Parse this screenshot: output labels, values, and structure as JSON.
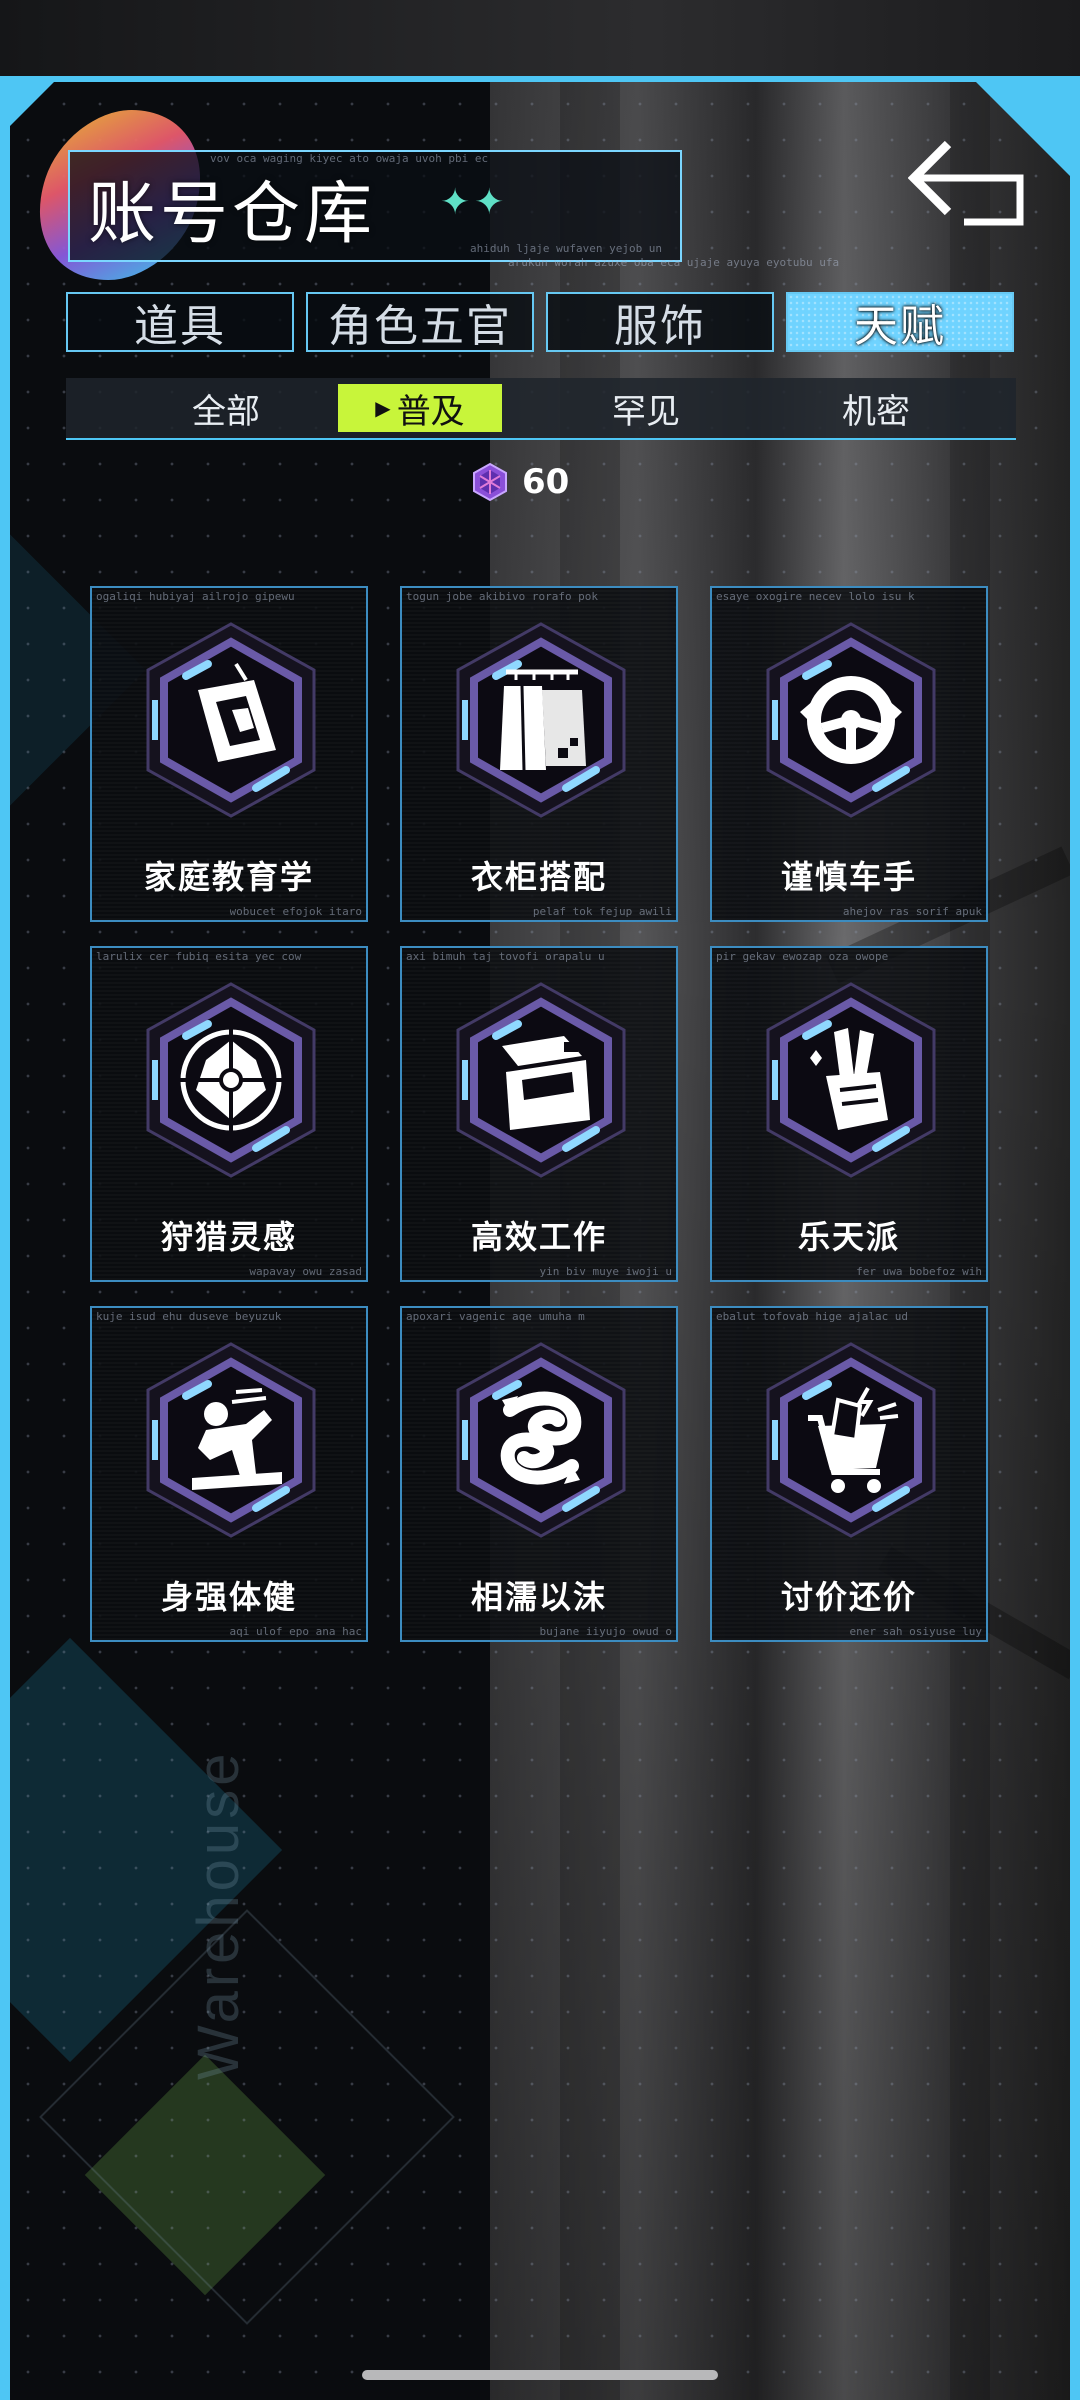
{
  "header": {
    "title": "账号仓库",
    "sparkles": "✦✦",
    "deco_line_1": "vov oca waging kiyec ato owaja uvoh pbi ec",
    "deco_line_2": "ahiduh ljaje wufaven yejob un",
    "deco_line_3": "arukun worah azuxe oba eca ujaje ayuya eyotubu ufa"
  },
  "back_button": {
    "icon": "back-arrow-icon"
  },
  "tabs": [
    {
      "label": "道具",
      "active": false
    },
    {
      "label": "角色五官",
      "active": false
    },
    {
      "label": "服饰",
      "active": false
    },
    {
      "label": "天赋",
      "active": true
    }
  ],
  "subtabs": [
    {
      "label": "全部",
      "active": false
    },
    {
      "label": "普及",
      "active": true
    },
    {
      "label": "罕见",
      "active": false
    },
    {
      "label": "机密",
      "active": false
    }
  ],
  "currency": {
    "icon": "gem-icon",
    "value": "60"
  },
  "cards": [
    {
      "name": "家庭教育学",
      "icon": "book-icon",
      "cap_top": "ogaliqi hubiyaj ailrojo gipewu",
      "cap_bot": "wobucet efojok itaro"
    },
    {
      "name": "衣柜搭配",
      "icon": "wardrobe-icon",
      "cap_top": "togun jobe akibivo rorafo pok",
      "cap_bot": "pelaf tok fejup awili"
    },
    {
      "name": "谨慎车手",
      "icon": "steering-wheel-icon",
      "cap_top": "esaye oxogire necev lolo isu k",
      "cap_bot": "ahejov ras sorif apuk"
    },
    {
      "name": "狩猎灵感",
      "icon": "crosshair-wolf-icon",
      "cap_top": "larulix cer fubiq esita yec cow",
      "cap_bot": "wapavay owu zasad"
    },
    {
      "name": "高效工作",
      "icon": "workstation-icon",
      "cap_top": "axi bimuh taj tovofi orapalu u",
      "cap_bot": "yin biv muye iwoji u"
    },
    {
      "name": "乐天派",
      "icon": "peace-hand-icon",
      "cap_top": "pir gekav ewozap oza owope",
      "cap_bot": "fer uwa bobefoz wih"
    },
    {
      "name": "身强体健",
      "icon": "runner-icon",
      "cap_top": "kuje isud ehu duseve beyuzuk",
      "cap_bot": "aqi ulof epo ana hac"
    },
    {
      "name": "相濡以沫",
      "icon": "koi-fish-icon",
      "cap_top": "apoxari vagenic aqe umuha m",
      "cap_bot": "bujane iiyujo owud o"
    },
    {
      "name": "讨价还价",
      "icon": "shopping-cart-icon",
      "cap_top": "ebalut tofovab hige ajalac ud",
      "cap_bot": "ener sah osiyuse luy"
    }
  ],
  "background": {
    "watermark": "Warehouse"
  },
  "colors": {
    "accent_blue": "#4ec6f4",
    "active_subtab": "#c8f53a",
    "card_border": "#3c8cc0"
  }
}
